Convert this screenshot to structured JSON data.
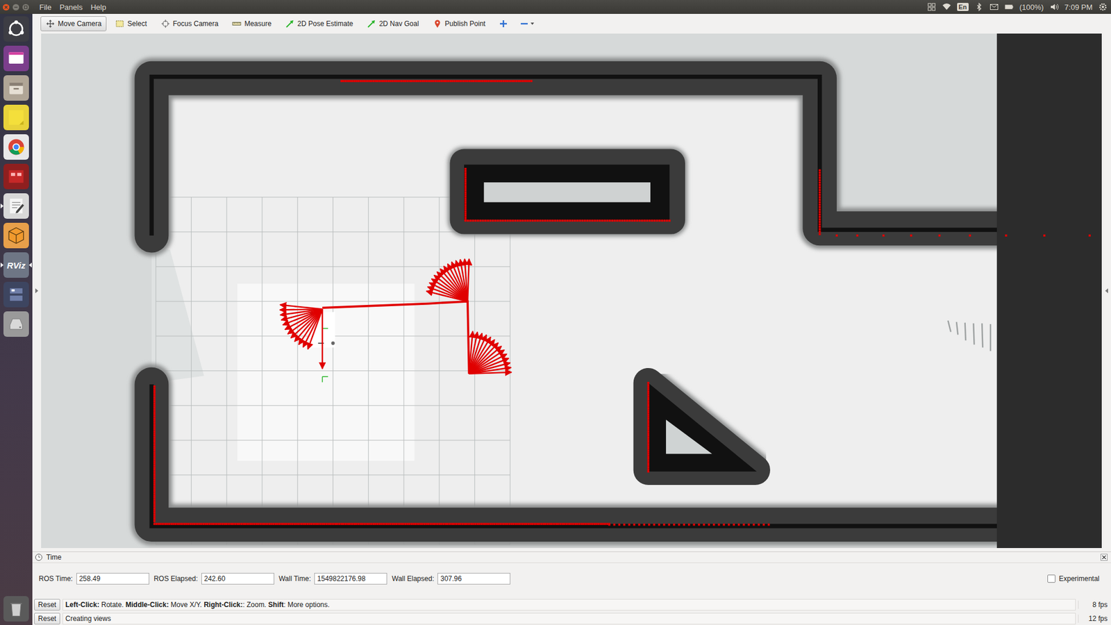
{
  "topbar": {
    "menus": [
      {
        "label": "File"
      },
      {
        "label": "Panels"
      },
      {
        "label": "Help"
      }
    ],
    "language": "En",
    "battery": "(100%)",
    "clock": "7:09 PM"
  },
  "launcher": [
    {
      "kind": "dash",
      "running": false,
      "focused": false
    },
    {
      "kind": "workspaces",
      "running": false,
      "focused": false
    },
    {
      "kind": "files",
      "running": false,
      "focused": false
    },
    {
      "kind": "notes",
      "running": false,
      "focused": false
    },
    {
      "kind": "chrome",
      "running": false,
      "focused": false
    },
    {
      "kind": "app-red",
      "running": false,
      "focused": false
    },
    {
      "kind": "editor",
      "running": true,
      "focused": false
    },
    {
      "kind": "box",
      "running": false,
      "focused": false
    },
    {
      "kind": "rviz",
      "text": "RViz",
      "running": true,
      "focused": true
    },
    {
      "kind": "switcher",
      "running": false,
      "focused": false
    },
    {
      "kind": "drive",
      "running": false,
      "focused": false
    },
    {
      "kind": "trash",
      "running": false,
      "focused": false
    }
  ],
  "toolbar": [
    {
      "label": "Move Camera",
      "kind": "move",
      "selected": true
    },
    {
      "label": "Select",
      "kind": "select",
      "selected": false
    },
    {
      "label": "Focus Camera",
      "kind": "focus",
      "selected": false
    },
    {
      "label": "Measure",
      "kind": "measure",
      "selected": false
    },
    {
      "label": "2D Pose Estimate",
      "kind": "pose",
      "selected": false
    },
    {
      "label": "2D Nav Goal",
      "kind": "goal",
      "selected": false
    },
    {
      "label": "Publish Point",
      "kind": "point",
      "selected": false
    }
  ],
  "time_panel": {
    "title": "Time",
    "fields": [
      {
        "label": "ROS Time:",
        "value": "258.49"
      },
      {
        "label": "ROS Elapsed:",
        "value": "242.60"
      },
      {
        "label": "Wall Time:",
        "value": "1549822176.98"
      },
      {
        "label": "Wall Elapsed:",
        "value": "307.96"
      }
    ],
    "experimental": {
      "label": "Experimental",
      "checked": false
    }
  },
  "status_rows": [
    {
      "button": "Reset",
      "segments": [
        {
          "text": "Left-Click:",
          "bold": true
        },
        {
          "text": " Rotate. ",
          "bold": false
        },
        {
          "text": "Middle-Click:",
          "bold": true
        },
        {
          "text": " Move X/Y. ",
          "bold": false
        },
        {
          "text": "Right-Click:",
          "bold": true
        },
        {
          "text": ": Zoom. ",
          "bold": false
        },
        {
          "text": "Shift",
          "bold": true
        },
        {
          "text": ": More options.",
          "bold": false
        }
      ],
      "fps": "8 fps"
    },
    {
      "button": "Reset",
      "segments": [
        {
          "text": "Creating views",
          "bold": false
        }
      ],
      "fps": "12 fps"
    }
  ]
}
